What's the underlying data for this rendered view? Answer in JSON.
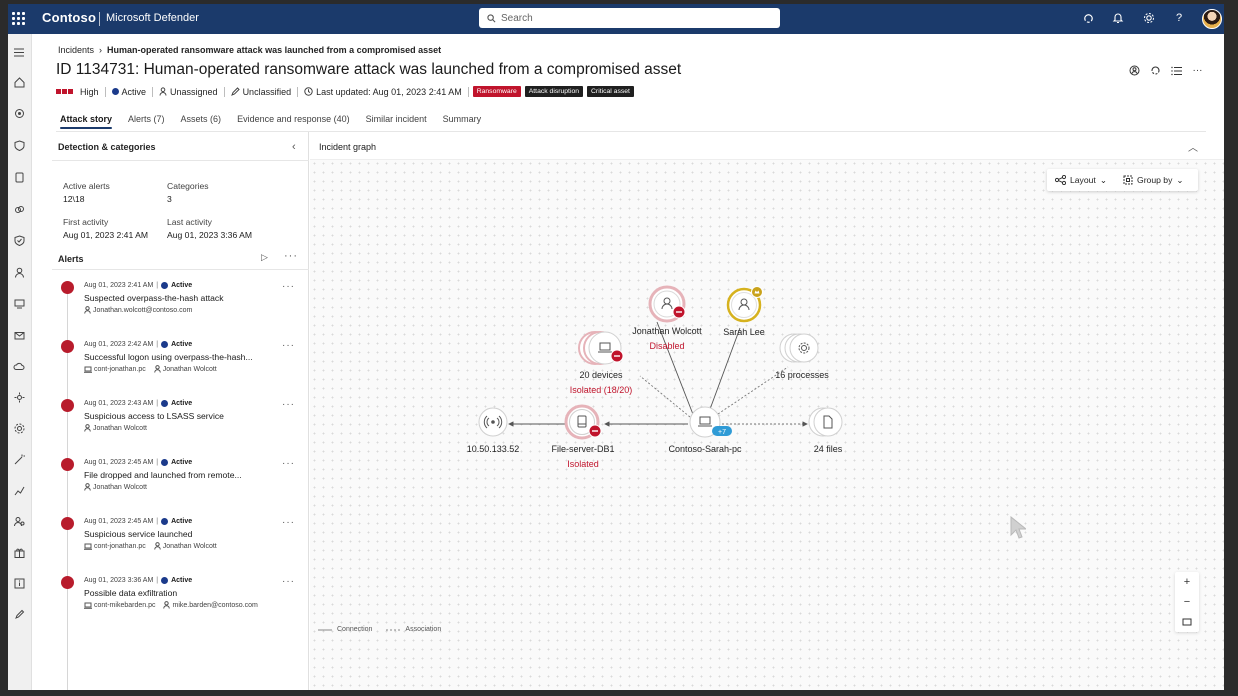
{
  "topbar": {
    "logo": "Contoso",
    "product": "Microsoft Defender",
    "search_placeholder": "Search"
  },
  "breadcrumb": {
    "root": "Incidents",
    "current": "Human-operated ransomware attack was launched from a compromised asset"
  },
  "page": {
    "title": "ID 1134731: Human-operated ransomware attack was launched from a compromised asset"
  },
  "meta": {
    "severity": "High",
    "status": "Active",
    "assignment": "Unassigned",
    "classification": "Unclassified",
    "last_updated": "Last updated: Aug 01, 2023 2:41 AM",
    "tags": [
      "Ransomware",
      "Attack disruption",
      "Critical asset"
    ]
  },
  "tabs": [
    "Attack story",
    "Alerts (7)",
    "Assets (6)",
    "Evidence and response (40)",
    "Similar incident",
    "Summary"
  ],
  "left_panel": {
    "title": "Detection & categories",
    "active_alerts_label": "Active alerts",
    "active_alerts_value": "12\\18",
    "categories_label": "Categories",
    "categories_value": "3",
    "first_activity_label": "First activity",
    "first_activity_value": "Aug 01, 2023 2:41 AM",
    "last_activity_label": "Last activity",
    "last_activity_value": "Aug 01, 2023 3:36 AM",
    "alerts_title": "Alerts"
  },
  "alerts": [
    {
      "time": "Aug 01, 2023 2:41 AM",
      "status": "Active",
      "name": "Suspected overpass-the-hash attack",
      "entities": [
        {
          "icon": "user-icon",
          "text": "Jonathan.wolcott@contoso.com"
        }
      ]
    },
    {
      "time": "Aug 01, 2023 2:42 AM",
      "status": "Active",
      "name": "Successful logon using overpass-the-hash...",
      "entities": [
        {
          "icon": "device-icon",
          "text": "cont-jonathan.pc"
        },
        {
          "icon": "user-icon",
          "text": "Jonathan Wolcott"
        }
      ]
    },
    {
      "time": "Aug 01, 2023 2:43 AM",
      "status": "Active",
      "name": "Suspicious access to LSASS service",
      "entities": [
        {
          "icon": "user-icon",
          "text": "Jonathan Wolcott"
        }
      ]
    },
    {
      "time": "Aug 01, 2023 2:45 AM",
      "status": "Active",
      "name": "File dropped and launched from remote...",
      "entities": [
        {
          "icon": "user-icon",
          "text": "Jonathan Wolcott"
        }
      ]
    },
    {
      "time": "Aug 01, 2023 2:45 AM",
      "status": "Active",
      "name": "Suspicious service launched",
      "entities": [
        {
          "icon": "device-icon",
          "text": "cont-jonathan.pc"
        },
        {
          "icon": "user-icon",
          "text": "Jonathan Wolcott"
        }
      ]
    },
    {
      "time": "Aug 01, 2023 3:36 AM",
      "status": "Active",
      "name": "Possible data exfiltration",
      "entities": [
        {
          "icon": "device-icon",
          "text": "cont-mikebarden.pc"
        },
        {
          "icon": "user-icon",
          "text": "mike.barden@contoso.com"
        }
      ]
    }
  ],
  "graph": {
    "title": "Incident graph",
    "layout_label": "Layout",
    "groupby_label": "Group by",
    "nodes": {
      "jonathan": {
        "label": "Jonathan Wolcott",
        "sub": "Disabled"
      },
      "sarah": {
        "label": "Sarah Lee"
      },
      "devices": {
        "label": "20 devices",
        "sub": "Isolated (18/20)"
      },
      "processes": {
        "label": "16 processes"
      },
      "ip": {
        "label": "10.50.133.52"
      },
      "fileserver": {
        "label": "File-server-DB1",
        "sub": "Isolated"
      },
      "contoso": {
        "label": "Contoso-Sarah-pc",
        "badge": "+7"
      },
      "files": {
        "label": "24 files"
      }
    },
    "legend": {
      "connection": "Connection",
      "association": "Association"
    }
  },
  "colors": {
    "topbar": "#1b3a6b",
    "severity": "#c0142c",
    "status_active": "#1b3a8b",
    "alert_dot": "#b81c2c",
    "badge_blue": "#2f9bd6",
    "sarah_ring": "#d6b21e"
  }
}
